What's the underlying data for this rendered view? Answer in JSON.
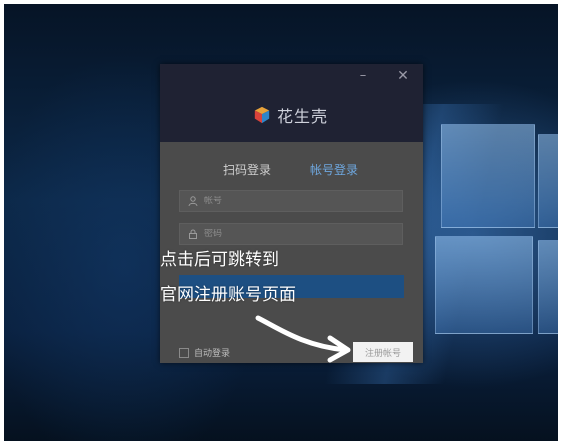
{
  "window": {
    "minimize_glyph": "–",
    "close_glyph": "✕",
    "app_name": "花生壳",
    "tabs": [
      {
        "label": "扫码登录"
      },
      {
        "label": "帐号登录"
      }
    ],
    "account_placeholder": "帐号",
    "password_placeholder": "密码",
    "auto_login_label": "自动登录",
    "register_label": "注册帐号"
  },
  "annotation": {
    "line1": "点击后可跳转到",
    "line2": "官网注册账号页面"
  },
  "colors": {
    "active_tab": "#6fa8e0",
    "highlight_bar": "#1d4f82",
    "titlebar": "#1f2233"
  }
}
